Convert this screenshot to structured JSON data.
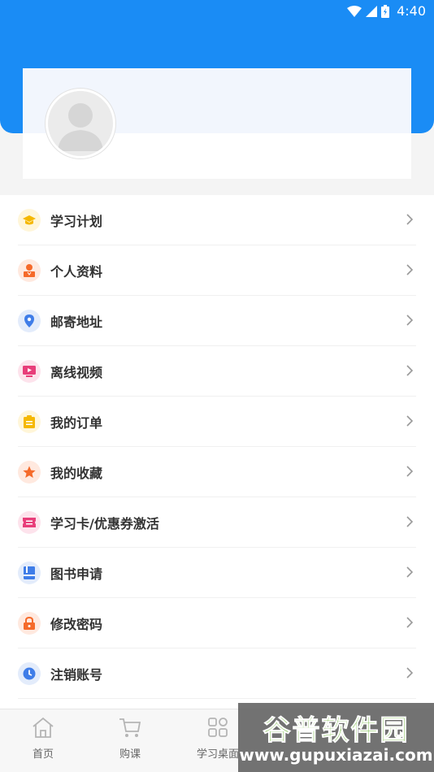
{
  "status": {
    "time": "4:40"
  },
  "menu": {
    "items": [
      {
        "label": "学习计划",
        "icon": "graduation-cap-icon",
        "color": "#f5b800",
        "bg": "#fff6d9"
      },
      {
        "label": "个人资料",
        "icon": "person-icon",
        "color": "#f56a2a",
        "bg": "#ffe9df"
      },
      {
        "label": "邮寄地址",
        "icon": "location-pin-icon",
        "color": "#3f7de8",
        "bg": "#e3ecfb"
      },
      {
        "label": "离线视频",
        "icon": "video-icon",
        "color": "#e83e7a",
        "bg": "#fde3ec"
      },
      {
        "label": "我的订单",
        "icon": "clipboard-icon",
        "color": "#f5b800",
        "bg": "#fff6d9"
      },
      {
        "label": "我的收藏",
        "icon": "star-icon",
        "color": "#f56a2a",
        "bg": "#ffe9df"
      },
      {
        "label": "学习卡/优惠券激活",
        "icon": "ticket-icon",
        "color": "#e83e7a",
        "bg": "#fde3ec"
      },
      {
        "label": "图书申请",
        "icon": "book-icon",
        "color": "#3f7de8",
        "bg": "#e3ecfb"
      },
      {
        "label": "修改密码",
        "icon": "lock-icon",
        "color": "#f56a2a",
        "bg": "#ffe9df"
      },
      {
        "label": "注销账号",
        "icon": "clock-icon",
        "color": "#3f7de8",
        "bg": "#e3ecfb"
      }
    ]
  },
  "tabbar": {
    "home": "首页",
    "buy": "购课",
    "desk": "学习桌面"
  },
  "watermark": {
    "title": "谷普软件园",
    "url": "www.gupuxiazai.com"
  }
}
